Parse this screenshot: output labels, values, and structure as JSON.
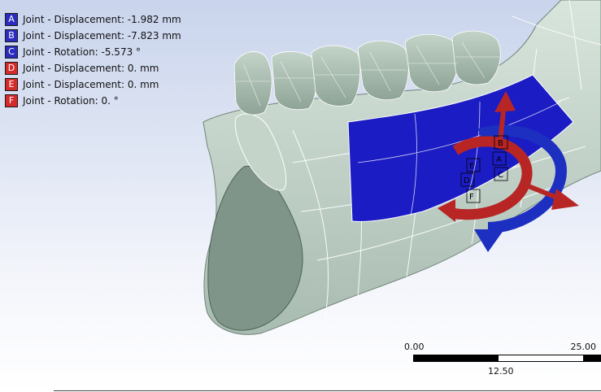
{
  "legend": {
    "items": [
      {
        "key": "A",
        "label": "Joint - Displacement: -1.982 mm",
        "color": "#2b2bbf"
      },
      {
        "key": "B",
        "label": "Joint - Displacement: -7.823 mm",
        "color": "#2b2bbf"
      },
      {
        "key": "C",
        "label": "Joint - Rotation: -5.573 °",
        "color": "#2b2bbf"
      },
      {
        "key": "D",
        "label": "Joint - Displacement: 0. mm",
        "color": "#d42a2a"
      },
      {
        "key": "E",
        "label": "Joint - Displacement: 0. mm",
        "color": "#d42a2a"
      },
      {
        "key": "F",
        "label": "Joint - Rotation: 0. °",
        "color": "#d42a2a"
      }
    ]
  },
  "triad_labels": [
    "B",
    "A",
    "E",
    "D",
    "C",
    "F"
  ],
  "scale": {
    "left": "0.00",
    "mid": "12.50",
    "right": "25.00"
  },
  "colors": {
    "mesh_fill": "#c8d8cf",
    "mesh_shade": "#9fb3a8",
    "mesh_line": "#ffffff",
    "selected_face": "#1c1cc4",
    "arrow_red": "#b82525",
    "arrow_blue": "#1c2fc0"
  }
}
